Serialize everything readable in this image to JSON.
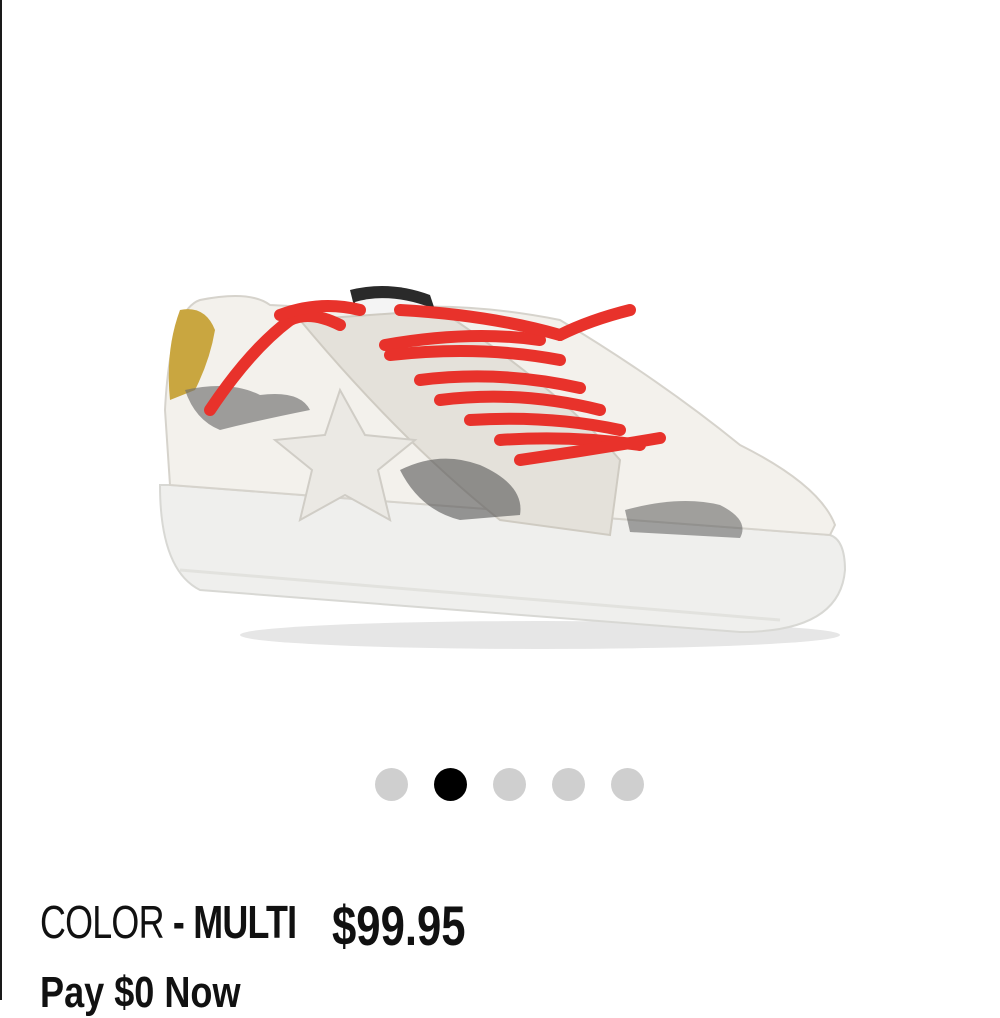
{
  "product": {
    "image_alt": "sneaker",
    "color_label": "COLOR",
    "color_separator": " - ",
    "color_value": "MULTI",
    "price": "$99.95",
    "pay_text": "Pay $0 Now"
  },
  "carousel": {
    "total": 5,
    "active_index": 1
  },
  "colors": {
    "lace": "#e8322b",
    "heel_tab": "#c9a640",
    "dot_inactive": "#cfcfcf",
    "dot_active": "#000000"
  }
}
